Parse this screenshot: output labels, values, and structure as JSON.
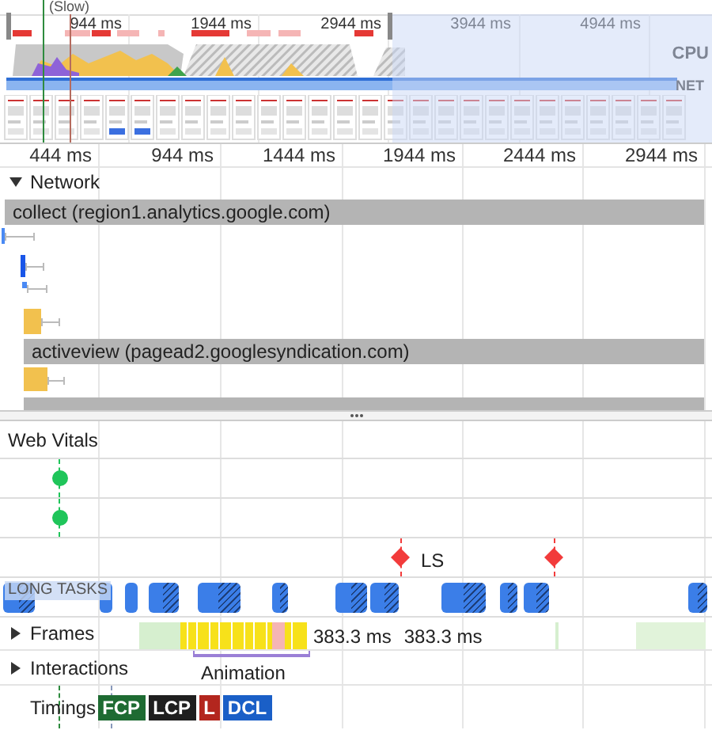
{
  "overview": {
    "throttle_note": "(Slow)",
    "ticks": [
      "944 ms",
      "1944 ms",
      "2944 ms",
      "3944 ms",
      "4944 ms"
    ],
    "cpu_label": "CPU",
    "net_label": "NET"
  },
  "ruler": {
    "ticks": [
      "444 ms",
      "944 ms",
      "1444 ms",
      "1944 ms",
      "2444 ms",
      "2944 ms"
    ]
  },
  "network": {
    "title": "Network",
    "expanded": true,
    "rows": [
      {
        "kind": "group",
        "label": "collect (region1.analytics.google.com)"
      },
      {
        "kind": "request",
        "color": "#4a8af4"
      },
      {
        "kind": "request",
        "color": "#1a56e8"
      },
      {
        "kind": "request",
        "color": "#4a8af4"
      },
      {
        "kind": "request",
        "color": "#f2c14e"
      },
      {
        "kind": "group",
        "label": "activeview (pagead2.googlesyndication.com)"
      },
      {
        "kind": "request",
        "color": "#f2c14e"
      },
      {
        "kind": "group"
      }
    ]
  },
  "web_vitals": {
    "title": "Web Vitals",
    "ls_label": "LS"
  },
  "long_tasks": {
    "label": "LONG TASKS"
  },
  "tracks": [
    {
      "kind": "frames",
      "label": "Frames",
      "expanded": false,
      "readings": [
        "383.3 ms",
        "383.3 ms"
      ]
    },
    {
      "kind": "interactions",
      "label": "Interactions",
      "expanded": false,
      "annotation": "Animation"
    },
    {
      "kind": "timings",
      "label": "Timings",
      "badges": [
        {
          "text": "FCP",
          "color": "#1e6b32"
        },
        {
          "text": "LCP",
          "color": "#1f1f1f"
        },
        {
          "text": "L",
          "color": "#b3261e"
        },
        {
          "text": "DCL",
          "color": "#1a5fc7"
        }
      ]
    }
  ]
}
